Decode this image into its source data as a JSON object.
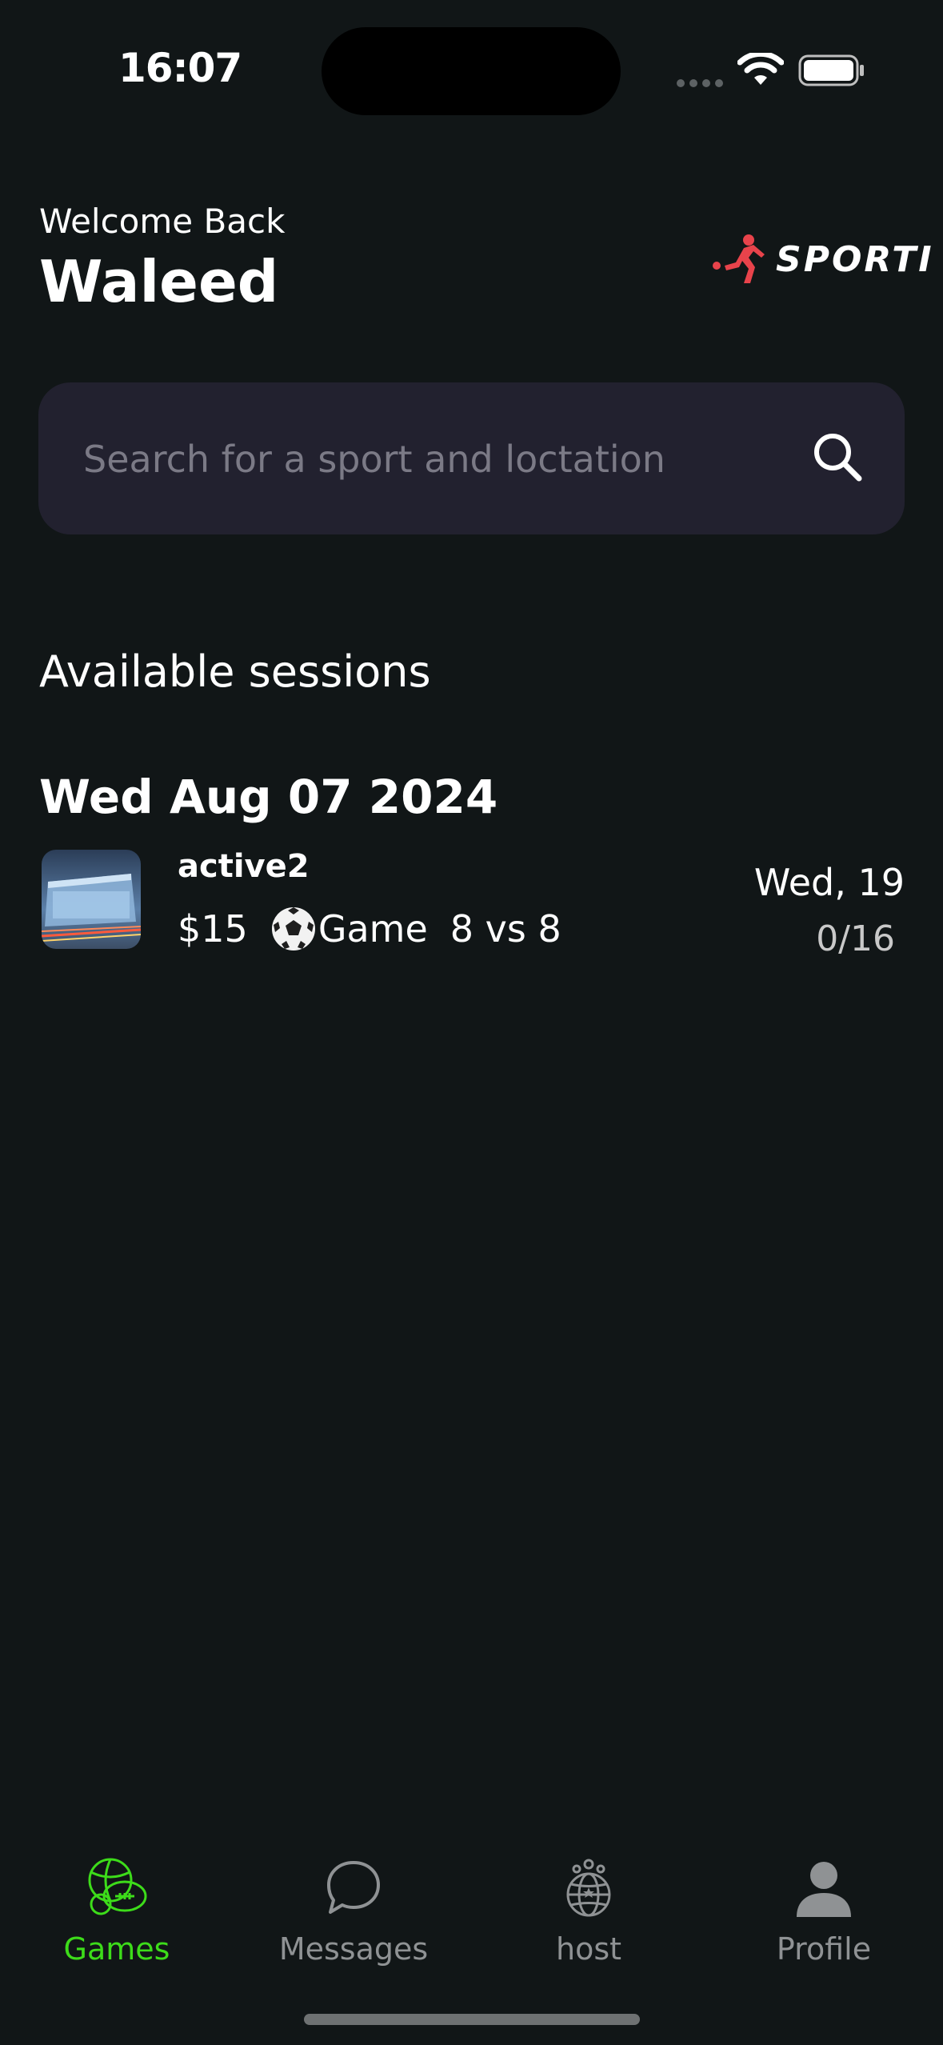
{
  "status_bar": {
    "time": "16:07"
  },
  "header": {
    "welcome_label": "Welcome Back",
    "user_name": "Waleed",
    "logo_text": "SPORTI",
    "logo_icon": "player-kicking-icon"
  },
  "search": {
    "placeholder": "Search for a sport and loctation",
    "value": "",
    "icon": "search-icon"
  },
  "sessions": {
    "section_title": "Available sessions",
    "groups": [
      {
        "date": "Wed Aug 07 2024",
        "items": [
          {
            "name": "active2",
            "price": "$15",
            "type_icon": "soccer-ball-icon",
            "type": "Game",
            "format": "8 vs 8",
            "day": "Wed, 19",
            "capacity": "0/16"
          }
        ]
      }
    ]
  },
  "tabs": [
    {
      "label": "Games",
      "icon": "sports-balls-icon",
      "active": true
    },
    {
      "label": "Messages",
      "icon": "chat-bubble-icon",
      "active": false
    },
    {
      "label": "host",
      "icon": "globe-people-icon",
      "active": false
    },
    {
      "label": "Profile",
      "icon": "person-icon",
      "active": false
    }
  ],
  "colors": {
    "background": "#111617",
    "search_background": "#22212f",
    "active_tab": "#3ddc1a",
    "inactive_tab": "#8f9294",
    "logo_accent": "#e8434b"
  }
}
